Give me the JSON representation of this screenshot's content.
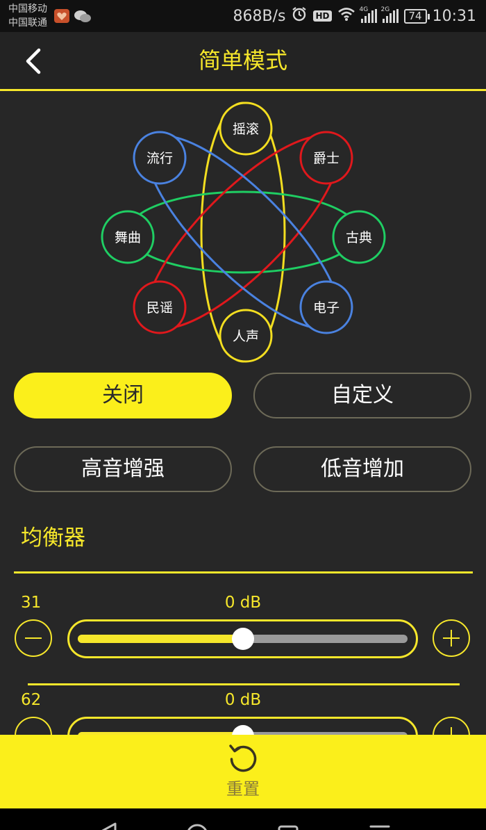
{
  "status_bar": {
    "carrier_1": "中国移动",
    "carrier_2": "中国联通",
    "net_speed": "868B/s",
    "hd_badge": "HD",
    "sig1_label": "4G",
    "sig2_label": "2G",
    "battery": "74",
    "time": "10:31",
    "icons": [
      "app-notification-icon",
      "wechat-icon",
      "alarm-icon",
      "wifi-icon",
      "signal-icon",
      "battery-icon"
    ]
  },
  "header": {
    "title": "简单模式",
    "back_icon": "chevron-left-icon"
  },
  "genres": [
    {
      "id": "rock",
      "label": "摇滚",
      "color": "#f3de20"
    },
    {
      "id": "jazz",
      "label": "爵士",
      "color": "#e0181c"
    },
    {
      "id": "classical",
      "label": "古典",
      "color": "#1fce63"
    },
    {
      "id": "electronic",
      "label": "电子",
      "color": "#4a82e0"
    },
    {
      "id": "vocal",
      "label": "人声",
      "color": "#f3de20"
    },
    {
      "id": "folk",
      "label": "民谣",
      "color": "#e0181c"
    },
    {
      "id": "dance",
      "label": "舞曲",
      "color": "#1fce63"
    },
    {
      "id": "pop",
      "label": "流行",
      "color": "#4a82e0"
    }
  ],
  "modes": [
    {
      "label": "关闭",
      "active": true
    },
    {
      "label": "自定义",
      "active": false
    },
    {
      "label": "高音增强",
      "active": false
    },
    {
      "label": "低音增加",
      "active": false
    }
  ],
  "equalizer": {
    "title": "均衡器",
    "bands": [
      {
        "freq": "31",
        "gain": "0 dB",
        "level": 0.5
      },
      {
        "freq": "62",
        "gain": "0 dB",
        "level": 0.5
      }
    ]
  },
  "reset": {
    "label": "重置",
    "icon": "reset-icon"
  },
  "nav": {
    "icons": [
      "back-triangle-icon",
      "home-circle-icon",
      "recents-square-icon",
      "menu-lines-icon"
    ]
  },
  "colors": {
    "accent": "#f6e72b",
    "background": "#272727",
    "active_button": "#fbef1b"
  }
}
